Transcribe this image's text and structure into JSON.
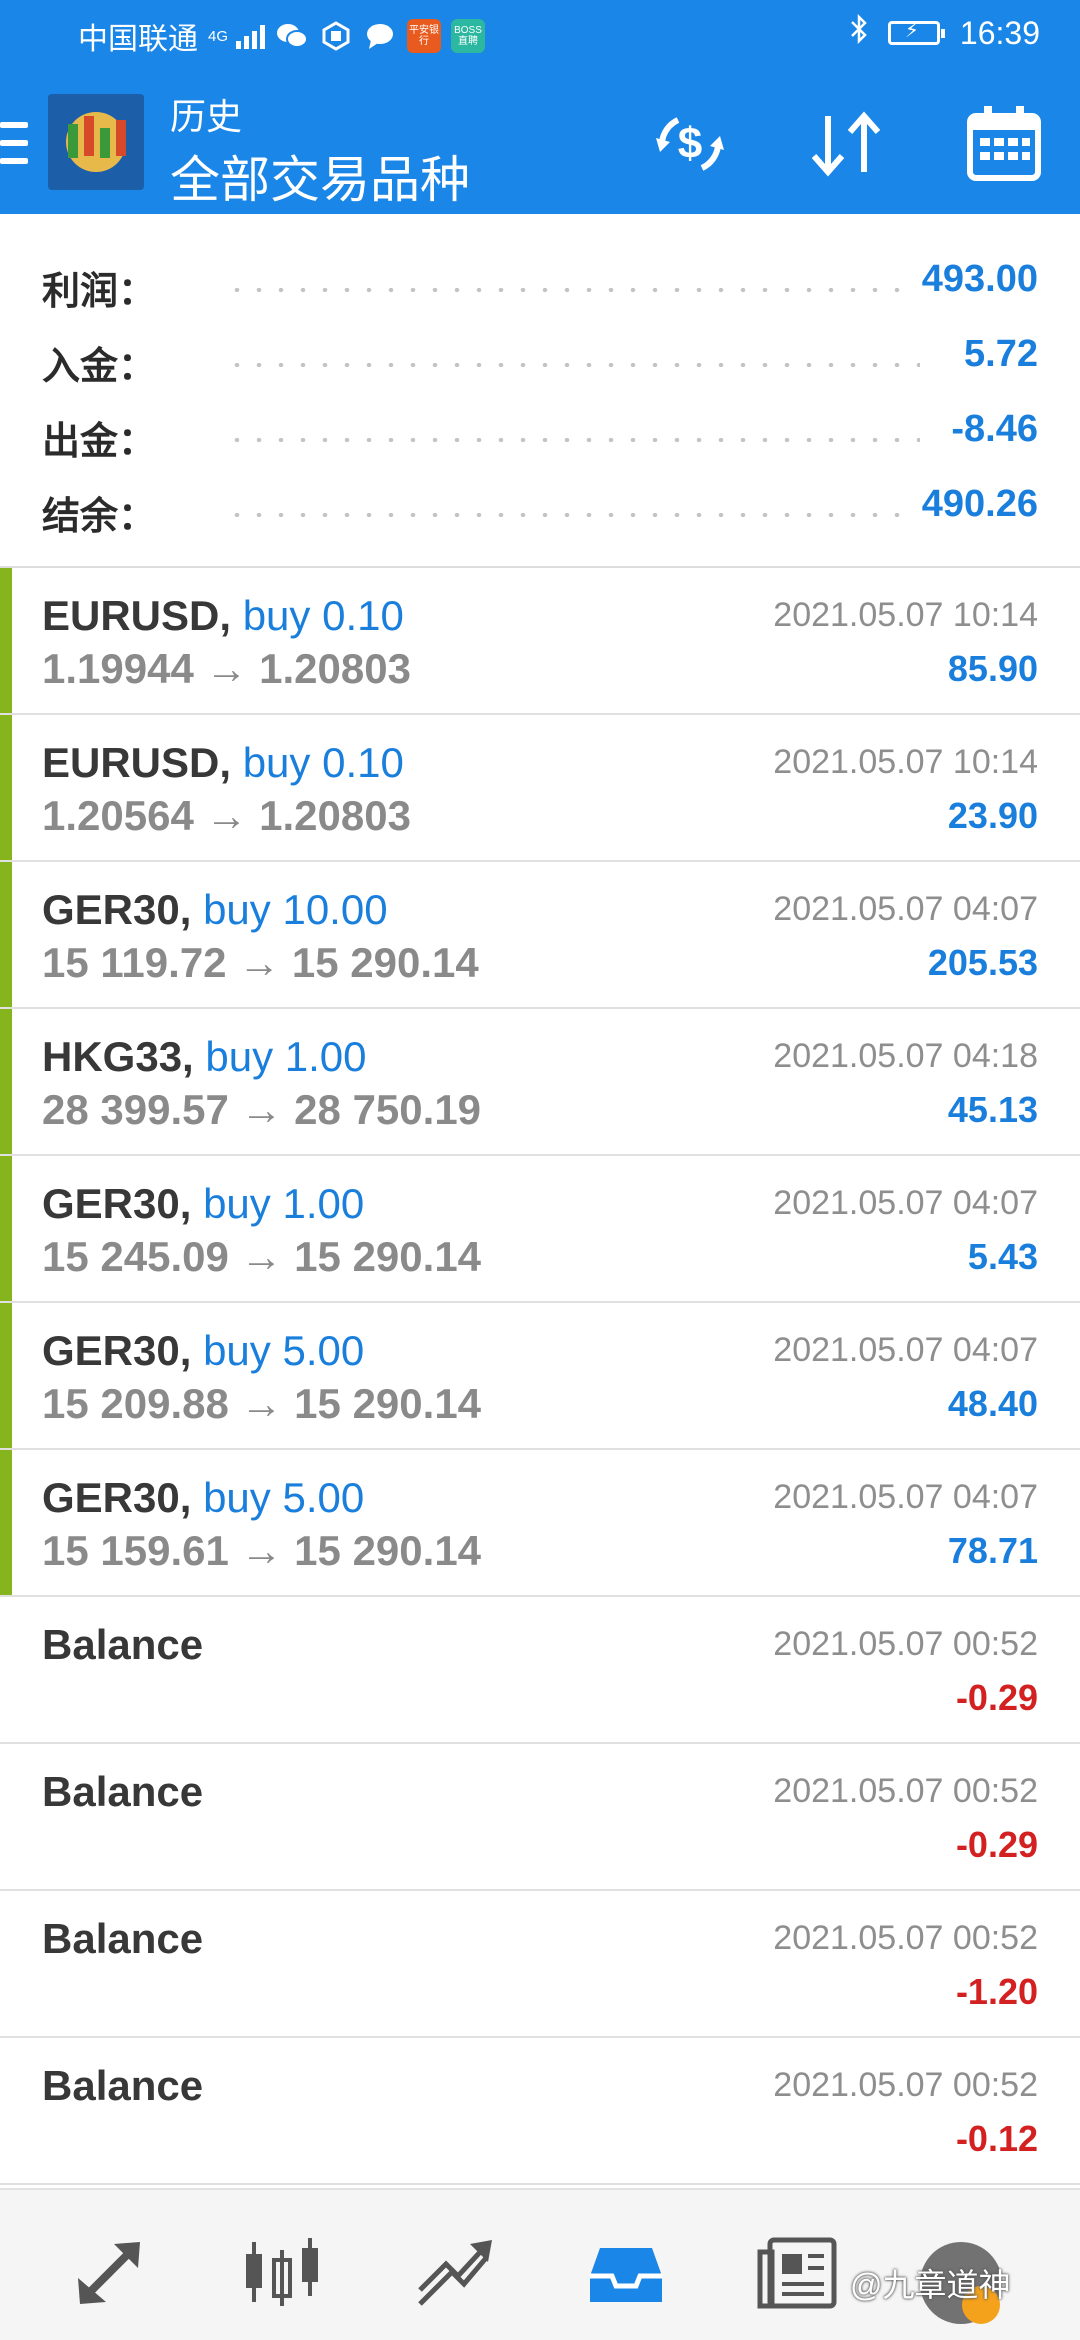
{
  "status_bar": {
    "carrier": "中国联通",
    "network": "4G",
    "bank_badge": "平安银行",
    "boss_badge": "BOSS直聘",
    "time": "16:39"
  },
  "app_bar": {
    "title": "历史",
    "subtitle": "全部交易品种"
  },
  "summary": {
    "profit_label": "利润：",
    "profit_value": "493.00",
    "deposit_label": "入金：",
    "deposit_value": "5.72",
    "withdraw_label": "出金：",
    "withdraw_value": "-8.46",
    "balance_label": "结余：",
    "balance_value": "490.26"
  },
  "trades": [
    {
      "symbol": "EURUSD,",
      "side": "buy 0.10",
      "prices": "1.19944 → 1.20803",
      "time": "2021.05.07 10:14",
      "profit": "85.90"
    },
    {
      "symbol": "EURUSD,",
      "side": "buy 0.10",
      "prices": "1.20564 → 1.20803",
      "time": "2021.05.07 10:14",
      "profit": "23.90"
    },
    {
      "symbol": "GER30,",
      "side": "buy 10.00",
      "prices": "15 119.72 → 15 290.14",
      "time": "2021.05.07 04:07",
      "profit": "205.53"
    },
    {
      "symbol": "HKG33,",
      "side": "buy 1.00",
      "prices": "28 399.57 → 28 750.19",
      "time": "2021.05.07 04:18",
      "profit": "45.13"
    },
    {
      "symbol": "GER30,",
      "side": "buy 1.00",
      "prices": "15 245.09 → 15 290.14",
      "time": "2021.05.07 04:07",
      "profit": "5.43"
    },
    {
      "symbol": "GER30,",
      "side": "buy 5.00",
      "prices": "15 209.88 → 15 290.14",
      "time": "2021.05.07 04:07",
      "profit": "48.40"
    },
    {
      "symbol": "GER30,",
      "side": "buy 5.00",
      "prices": "15 159.61 → 15 290.14",
      "time": "2021.05.07 04:07",
      "profit": "78.71"
    }
  ],
  "balances": [
    {
      "label": "Balance",
      "time": "2021.05.07 00:52",
      "amount": "-0.29"
    },
    {
      "label": "Balance",
      "time": "2021.05.07 00:52",
      "amount": "-0.29"
    },
    {
      "label": "Balance",
      "time": "2021.05.07 00:52",
      "amount": "-1.20"
    },
    {
      "label": "Balance",
      "time": "2021.05.07 00:52",
      "amount": "-0.12"
    }
  ],
  "watermark": "@九章道神",
  "colors": {
    "app_bar": "#1a86e8",
    "profit_positive": "#1a7fdc",
    "profit_negative": "#d32020",
    "buy_edge": "#86b41c"
  },
  "icons": {
    "app_bar_actions": [
      "currency-exchange-icon",
      "sort-icon",
      "calendar-icon"
    ],
    "bottom_nav": [
      "quotes-icon",
      "chart-icon",
      "trade-icon",
      "history-icon",
      "news-icon"
    ]
  }
}
